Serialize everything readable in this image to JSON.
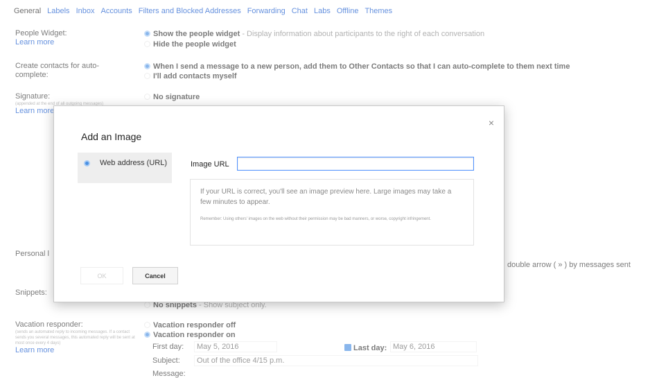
{
  "tabs": [
    "General",
    "Labels",
    "Inbox",
    "Accounts",
    "Filters and Blocked Addresses",
    "Forwarding",
    "Chat",
    "Labs",
    "Offline",
    "Themes"
  ],
  "people_widget": {
    "label": "People Widget:",
    "learn_more": "Learn more",
    "show_bold": "Show the people widget",
    "show_desc": " - Display information about participants to the right of each conversation",
    "hide": "Hide the people widget"
  },
  "contacts": {
    "label": "Create contacts for auto-complete:",
    "opt1": "When I send a message to a new person, add them to Other Contacts so that I can auto-complete to them next time",
    "opt2": "I'll add contacts myself"
  },
  "signature": {
    "label": "Signature:",
    "sub": "(appended at the end of all outgoing messages)",
    "learn_more": "Learn more",
    "none": "No signature"
  },
  "personal": {
    "label": "Personal l",
    "right_text": "double arrow ( » ) by messages sent"
  },
  "snippets": {
    "label": "Snippets:",
    "none_bold": "No snippets",
    "none_desc": " - Show subject only."
  },
  "vacation": {
    "label": "Vacation responder:",
    "sub": "(sends an automated reply to incoming messages. If a contact sends you several messages, this automated reply will be sent at most once every 4 days)",
    "learn_more": "Learn more",
    "off": "Vacation responder off",
    "on": "Vacation responder on",
    "first_day_label": "First day:",
    "first_day_value": "May 5, 2016",
    "last_day_label": "Last day:",
    "last_day_value": "May 6, 2016",
    "subject_label": "Subject:",
    "subject_value": "Out of the office 4/15 p.m.",
    "message_label": "Message:"
  },
  "modal": {
    "title": "Add an Image",
    "close": "×",
    "source_label": "Web address (URL)",
    "url_label": "Image URL",
    "url_value": "",
    "preview_text": "If your URL is correct, you'll see an image preview here. Large images may take a few minutes to appear.",
    "preview_note": "Remember: Using others' images on the web without their permission may be bad manners, or worse, copyright infringement.",
    "ok_label": "OK",
    "cancel_label": "Cancel"
  },
  "colors": {
    "accent": "#4d90fe",
    "link": "#1155cc",
    "radio": "#4a90e2"
  }
}
